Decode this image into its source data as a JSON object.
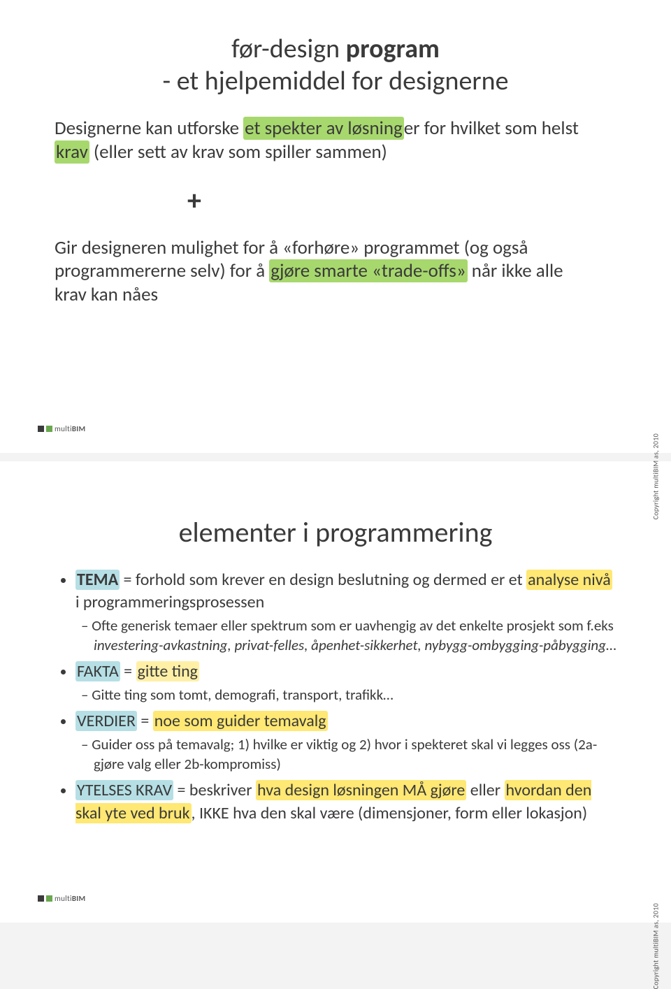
{
  "slide1": {
    "title_pre": "før-design ",
    "title_bold": "program",
    "title_line2": "- et hjelpemiddel for designerne",
    "p1_a": "Designerne kan utforske ",
    "p1_hl1": "et spekter av løsning",
    "p1_b": "er for hvilket som helst ",
    "p1_hl2": "krav",
    "p1_c": " (eller sett av krav som spiller sammen)",
    "plus": "+",
    "p2_a": "Gir designeren mulighet for å «forhøre» programmet (og også programmererne selv) for å ",
    "p2_hl1": "gjøre smarte «trade-offs»",
    "p2_b": " når ikke alle krav kan nåes",
    "logo_text_pre": "multi",
    "logo_text_bold": "BIM",
    "copyright": "Copyright multiBIM as, 2010"
  },
  "slide2": {
    "title": "elementer i programmering",
    "b1": {
      "hl_tema": "TEMA",
      "txt_a": " = forhold som krever en design beslutning  og dermed er et ",
      "hl_analyse": "analyse nivå",
      "txt_b": " i programmeringsprosessen",
      "sub_a": "Ofte generisk temaer eller spektrum som er uavhengig av det enkelte prosjekt som f.eks ",
      "sub_italic": "investering-avkastning, privat-felles, åpenhet-sikkerhet, nybygg-ombygging-påbygging",
      "sub_b": "…"
    },
    "b2": {
      "hl_fakta": "FAKTA",
      "txt_eq": " = ",
      "hl_gitte": "gitte ting",
      "sub": "Gitte ting som tomt, demografi, transport, trafikk…"
    },
    "b3": {
      "hl_verdier": "VERDIER",
      "txt_eq": " = ",
      "hl_noe": "noe som guider temavalg",
      "sub": "Guider oss på temavalg; 1) hvilke er viktig og 2) hvor i spekteret skal vi legges oss (2a-gjøre valg eller 2b-kompromiss)"
    },
    "b4": {
      "hl_ytelses": "YTELSES KRAV",
      "txt_a": " = beskriver ",
      "hl_hva": "hva design løsningen MÅ gjøre",
      "txt_b": " eller ",
      "hl_hvordan": "hvordan den skal yte ved bruk",
      "txt_c": ", IKKE hva den skal være (dimensjoner, form eller lokasjon)"
    },
    "logo_text_pre": "multi",
    "logo_text_bold": "BIM",
    "copyright": "Copyright multiBIM as, 2010"
  }
}
